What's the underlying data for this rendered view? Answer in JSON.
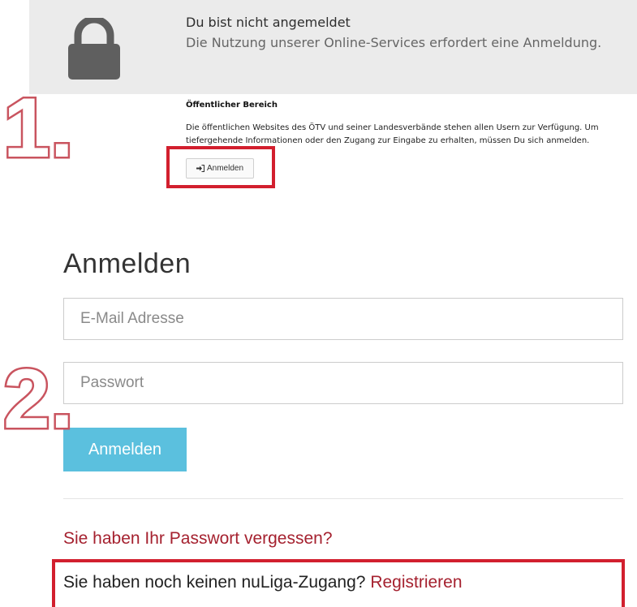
{
  "notice": {
    "icon": "lock-icon",
    "title": "Du bist nicht angemeldet",
    "text": "Die Nutzung unserer Online-Services erfordert eine Anmeldung."
  },
  "public_area": {
    "heading": "Öffentlicher Bereich",
    "text": "Die öffentlichen Websites des ÖTV und seiner Landesverbände stehen allen Usern zur Verfügung. Um tiefergehende Informationen oder den Zugang zur Eingabe zu erhalten, müssen Du sich anmelden.",
    "login_icon": "sign-in-icon",
    "login_label": "Anmelden"
  },
  "steps": {
    "one": "1.",
    "two": "2."
  },
  "login_form": {
    "title": "Anmelden",
    "email_placeholder": "E-Mail Adresse",
    "password_placeholder": "Passwort",
    "submit_label": "Anmelden",
    "forgot_password": "Sie haben Ihr Passwort vergessen?",
    "no_account_text": "Sie haben noch keinen nuLiga-Zugang?",
    "register_link": "Registrieren"
  },
  "colors": {
    "accent_button": "#5bc0de",
    "link": "#a5212f",
    "highlight_box": "#d21f2e",
    "step_number_outline": "#c9545f"
  }
}
